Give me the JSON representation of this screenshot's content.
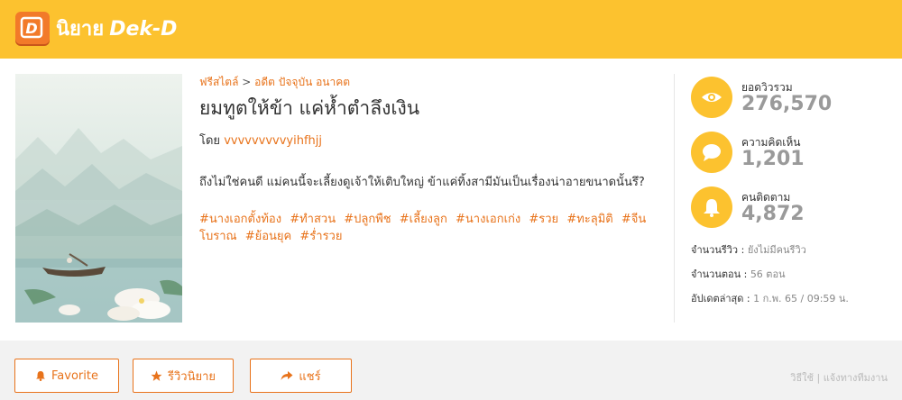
{
  "header": {
    "logo_label": "นิยาย",
    "brand": "Dek-D"
  },
  "novel": {
    "breadcrumb_category": "ฟรีสไตล์",
    "breadcrumb_separator": ">",
    "breadcrumb_sub": "อดีต ปัจจุบัน อนาคต",
    "title": "ยมทูตให้ข้า แค่ห้ำตำลึงเงิน",
    "author_prefix": "โดย",
    "author": "vvvvvvvvvyihfhjj",
    "synopsis": "ถึงไม่ใช่คนดี แม่คนนี้จะเลี้ยงดูเจ้าให้เติบใหญ่ ข้าแค่ทิ้งสามีมันเป็นเรื่องน่าอายขนาดนั้นรึ?",
    "tags": [
      "#นางเอกตั้งท้อง",
      "#ทำสวน",
      "#ปลูกพืช",
      "#เลี้ยงลูก",
      "#นางเอกเก่ง",
      "#รวย",
      "#ทะลุมิติ",
      "#จีนโบราณ",
      "#ย้อนยุค",
      "#ร่ำรวย"
    ]
  },
  "stats": {
    "views_label": "ยอดวิวรวม",
    "views": "276,570",
    "comments_label": "ความคิดเห็น",
    "comments": "1,201",
    "followers_label": "คนติดตาม",
    "followers": "4,872"
  },
  "meta": {
    "reviews_label": "จำนวนรีวิว :",
    "reviews_value": "ยังไม่มีคนรีวิว",
    "episodes_label": "จำนวนตอน :",
    "episodes_value": "56 ตอน",
    "updated_label": "อัปเดตล่าสุด :",
    "updated_value": "1 ก.พ. 65 / 09:59 น."
  },
  "actions": {
    "favorite": "Favorite",
    "review": "รีวิวนิยาย",
    "share": "แชร์"
  },
  "footer": {
    "link1": "วิธีใช้",
    "separator": "|",
    "link2": "แจ้งทางทีมงาน"
  },
  "colors": {
    "brand_yellow": "#fcc22f",
    "accent_orange": "#e8731b",
    "logo_orange": "#f27a29"
  },
  "icons": [
    "eye-icon",
    "comment-icon",
    "bell-icon",
    "bell-small-icon",
    "star-icon",
    "share-icon"
  ]
}
